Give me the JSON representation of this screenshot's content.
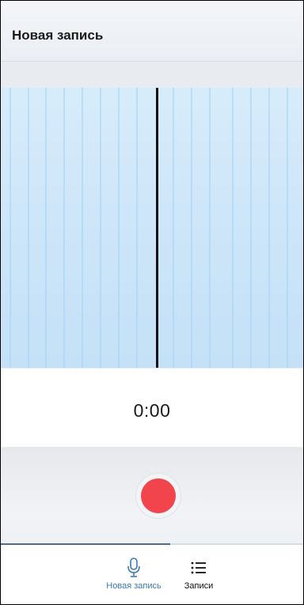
{
  "header": {
    "title": "Новая запись"
  },
  "timer": {
    "value": "0:00"
  },
  "progress": {
    "fraction": 0.56
  },
  "tabs": [
    {
      "label": "Новая запись",
      "icon": "microphone-icon",
      "active": true
    },
    {
      "label": "Записи",
      "icon": "list-icon",
      "active": false
    }
  ],
  "colors": {
    "record": "#f2444c",
    "active_tab": "#3f78b7",
    "waveform_bg": "#cbe4f8"
  }
}
